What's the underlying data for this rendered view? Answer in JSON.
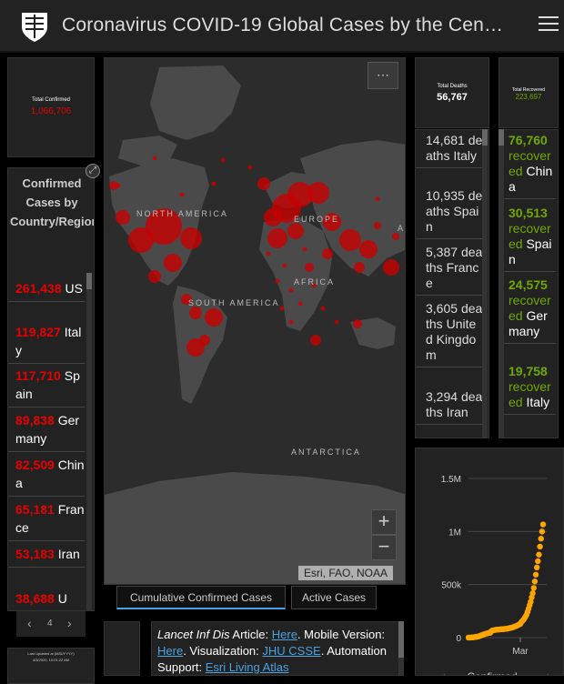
{
  "header": {
    "title": "Coronavirus COVID-19 Global Cases by the Cen…"
  },
  "total_confirmed": {
    "label": "Total Confirmed",
    "value": "1,066,706"
  },
  "confirmed_list": {
    "title": "Confirmed Cases by Country/Region/Sovereignty",
    "items": [
      {
        "count": "261,438",
        "name": "US"
      },
      {
        "count": "119,827",
        "name": "Italy"
      },
      {
        "count": "117,710",
        "name": "Spain"
      },
      {
        "count": "89,838",
        "name": "Germany"
      },
      {
        "count": "82,509",
        "name": "China"
      },
      {
        "count": "65,181",
        "name": "France"
      },
      {
        "count": "53,183",
        "name": "Iran"
      },
      {
        "count": "38,688",
        "name": "U"
      }
    ]
  },
  "map": {
    "labels": {
      "north_america": "NORTH AMERICA",
      "south_america": "SOUTH AMERICA",
      "europe": "EUROPE",
      "africa": "AFRICA",
      "antarctica": "ANTARCTICA",
      "asia": "A"
    },
    "attribution": "Esri, FAO, NOAA",
    "more_label": "⋯",
    "zoom_in": "+",
    "zoom_out": "−"
  },
  "map_tabs": {
    "cumulative": "Cumulative Confirmed Cases",
    "active": "Active Cases"
  },
  "deaths": {
    "label": "Total Deaths",
    "value": "56,767",
    "items": [
      {
        "count": "14,681",
        "label": "deaths",
        "name": "Italy"
      },
      {
        "count": "10,935",
        "label": "deaths",
        "name": "Spain"
      },
      {
        "count": "5,387",
        "label": "deaths",
        "name": "France"
      },
      {
        "count": "3,605",
        "label": "deaths",
        "name": "United Kingdom"
      },
      {
        "count": "3,294",
        "label": "deaths",
        "name": "Iran"
      }
    ]
  },
  "recovered": {
    "label": "Total Recovered",
    "value": "223,697",
    "items": [
      {
        "count": "76,760",
        "label": "recovered",
        "name": "China"
      },
      {
        "count": "30,513",
        "label": "recovered",
        "name": "Spain"
      },
      {
        "count": "24,575",
        "label": "recovered",
        "name": "Germany"
      },
      {
        "count": "19,758",
        "label": "recovered",
        "name": "Italy"
      }
    ]
  },
  "chart_data": {
    "type": "scatter",
    "y_ticks": [
      "1.5M",
      "1M",
      "500k",
      "0"
    ],
    "x_ticks": [
      "Mar"
    ],
    "ylim": [
      0,
      1500000
    ],
    "series": [
      {
        "color": "#ffa500",
        "values": [
          555,
          654,
          941,
          1434,
          2118,
          2927,
          5578,
          6166,
          8234,
          9927,
          12038,
          16787,
          19881,
          23892,
          27636,
          30818,
          34392,
          37121,
          40151,
          42763,
          44803,
          45222,
          60370,
          66887,
          69032,
          71226,
          73260,
          75138,
          75641,
          76199,
          76843,
          78599,
          78985,
          79570,
          80415,
          81397,
          82756,
          84124,
          86013,
          88371,
          90309,
          92844,
          95124,
          97886,
          101800,
          105847,
          109821,
          113590,
          118620,
          125875,
          128352,
          145205,
          156101,
          167454,
          181574,
          197102,
          214821,
          242570,
          272208,
          304507,
          336953,
          378235,
          418045,
          467653,
          529591,
          593291,
          660706,
          720117,
          782365,
          857487,
          932605,
          1000036,
          1066706
        ]
      }
    ],
    "legend_label": "Confirmed"
  },
  "last_updated": {
    "label": "Last Updated at (M/D/YYYY)",
    "value": "4/3/2020, 10:01:22 AM"
  },
  "info": {
    "article_title": "Lancet Inf Dis",
    "article_prefix": " Article: ",
    "here1": "Here",
    "mobile_text": ". Mobile Version: ",
    "here2": "Here",
    "viz_text": ". Visualization: ",
    "jhu": "JHU CSSE",
    "auto_text": ". Automation Support: ",
    "esri": "Esri Living Atlas"
  },
  "pager": {
    "prev": "‹",
    "page": "4",
    "next": "›"
  },
  "colors": {
    "confirmed": "#e60000",
    "recovered": "#70a800",
    "chart": "#ffa500",
    "link": "#4aa3df"
  }
}
